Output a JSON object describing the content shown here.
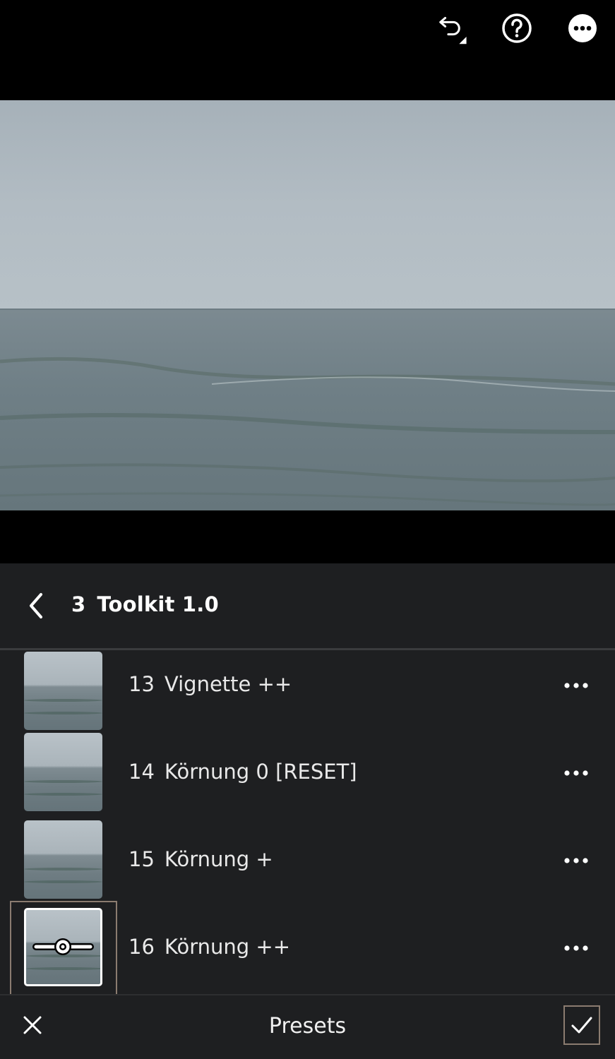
{
  "toolbar": {
    "icons": [
      "undo-icon",
      "help-icon",
      "more-icon"
    ]
  },
  "photo": {
    "subject": "sea-horizon-photo"
  },
  "panel": {
    "back_icon": "chevron-left-icon",
    "group_number": "3",
    "group_name": "Toolkit 1.0"
  },
  "presets": [
    {
      "number": "13",
      "name": "Vignette ++",
      "selected": false
    },
    {
      "number": "14",
      "name": "Körnung 0 [RESET]",
      "selected": false
    },
    {
      "number": "15",
      "name": "Körnung +",
      "selected": false
    },
    {
      "number": "16",
      "name": "Körnung ++",
      "selected": true
    }
  ],
  "bottom_bar": {
    "title": "Presets",
    "close_icon": "close-icon",
    "confirm_icon": "checkmark-icon"
  },
  "colors": {
    "panel_bg": "#1e1f21",
    "selection_border": "#8b7c70",
    "text": "#e9e9e9"
  }
}
